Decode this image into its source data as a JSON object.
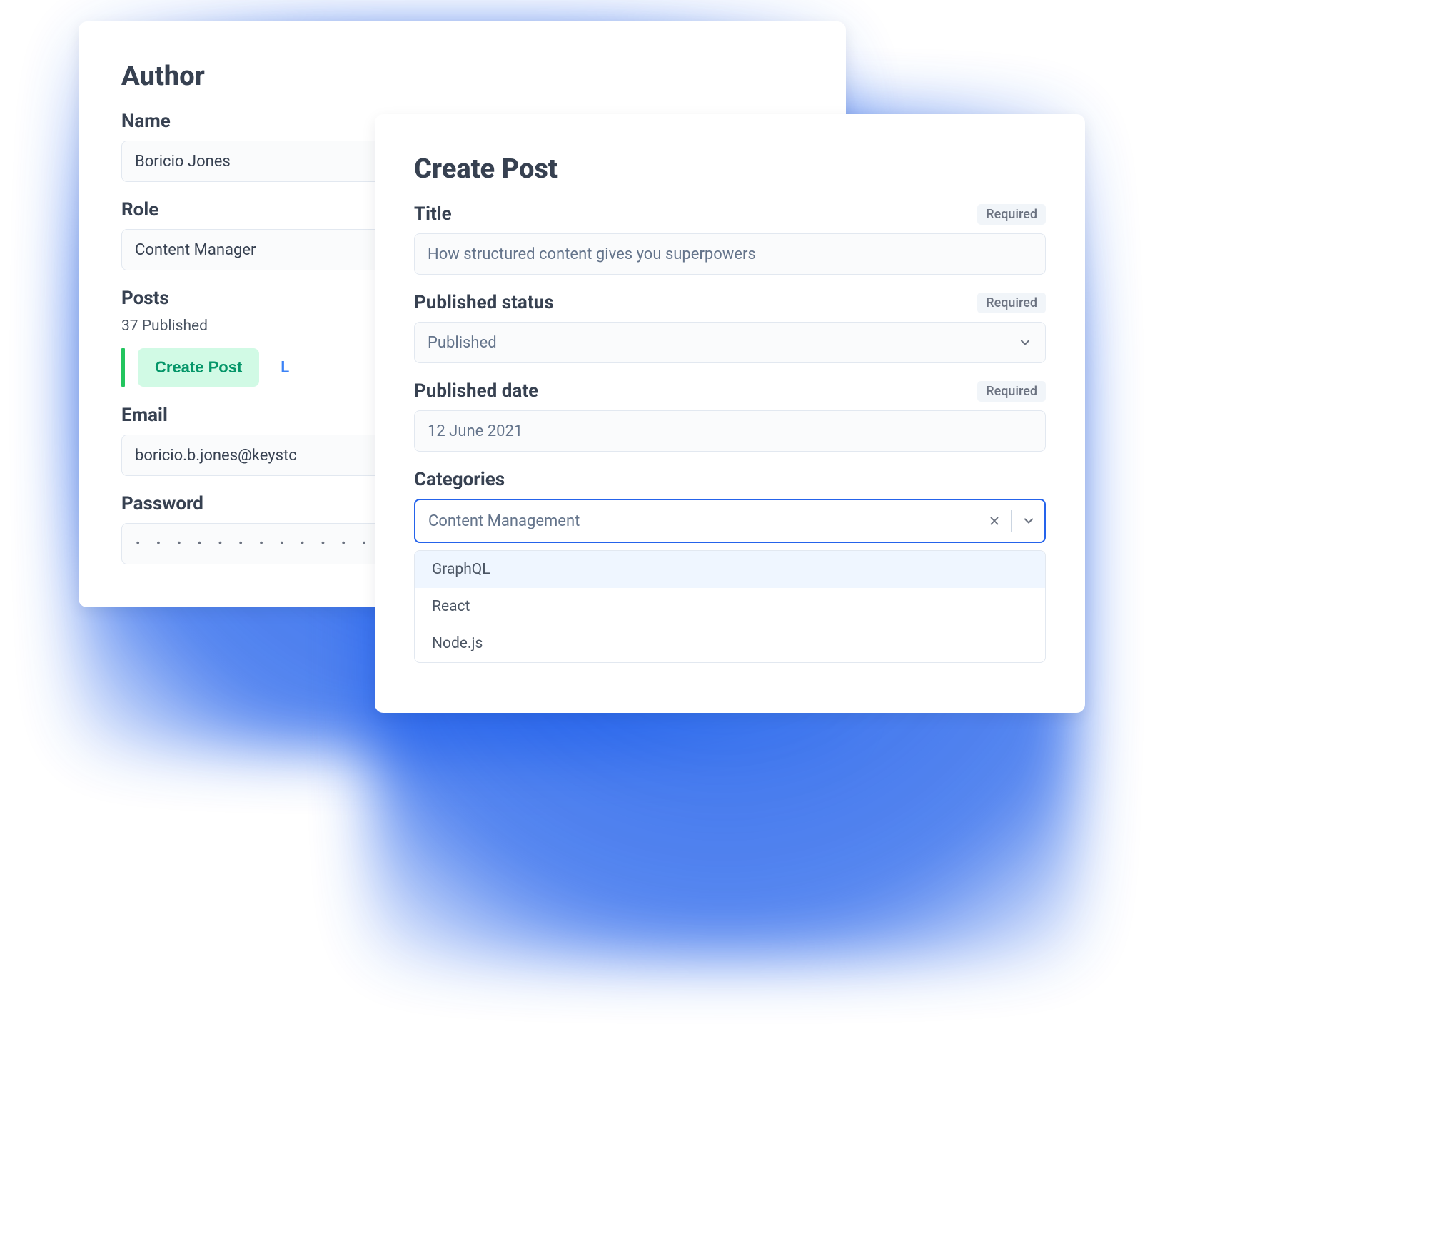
{
  "author_card": {
    "title": "Author",
    "name_label": "Name",
    "name_value": "Boricio Jones",
    "role_label": "Role",
    "role_value": "Content Manager",
    "posts_label": "Posts",
    "posts_stat": "37 Published",
    "create_post_label": "Create Post",
    "link_fragment": "L",
    "email_label": "Email",
    "email_value": "boricio.b.jones@keystc",
    "password_label": "Password",
    "password_dots": "• • • • • • • • • • • • • • • • • • • • • • • • • •"
  },
  "post_card": {
    "title": "Create Post",
    "title_label": "Title",
    "title_value": "How structured content gives you superpowers",
    "status_label": "Published status",
    "status_value": "Published",
    "date_label": "Published date",
    "date_value": "12 June 2021",
    "categories_label": "Categories",
    "categories_value": "Content Management",
    "required_label": "Required",
    "options": [
      "GraphQL",
      "React",
      "Node.js"
    ]
  }
}
